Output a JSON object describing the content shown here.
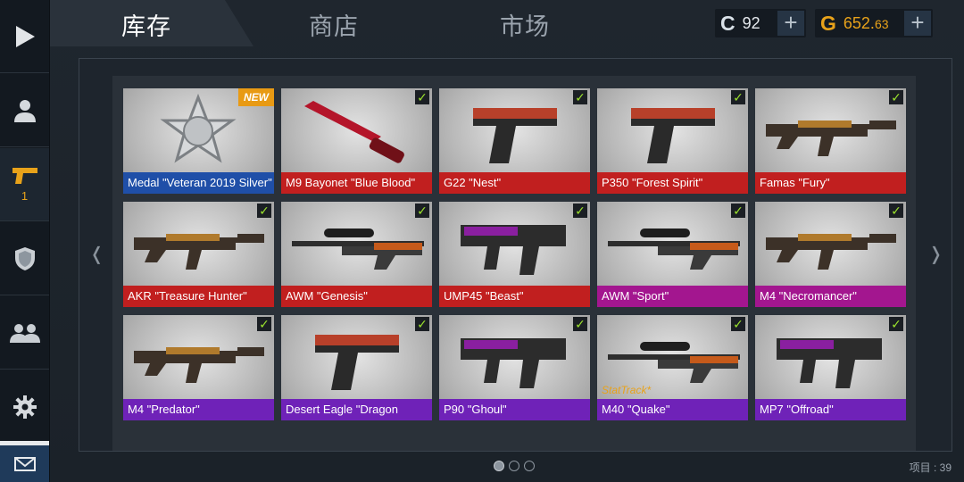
{
  "tabs": [
    {
      "label": "库存",
      "active": true
    },
    {
      "label": "商店",
      "active": false
    },
    {
      "label": "市场",
      "active": false
    }
  ],
  "currency": {
    "credits": {
      "icon": "C",
      "value": "92"
    },
    "gold": {
      "icon": "G",
      "value_main": "652.",
      "value_fraction": "63"
    }
  },
  "sidebar": {
    "inventory_count": "1"
  },
  "items": [
    {
      "name": "Medal \"Veteran 2019 Silver\"",
      "rarity_color": "#1f4fa8",
      "badge": "NEW",
      "icon": "medal-icon"
    },
    {
      "name": "M9 Bayonet \"Blue Blood\"",
      "rarity_color": "#c11f1f",
      "icon": "knife-icon"
    },
    {
      "name": "G22 \"Nest\"",
      "rarity_color": "#c11f1f",
      "icon": "pistol-icon"
    },
    {
      "name": "P350 \"Forest Spirit\"",
      "rarity_color": "#c11f1f",
      "icon": "pistol-icon"
    },
    {
      "name": "Famas \"Fury\"",
      "rarity_color": "#c11f1f",
      "icon": "rifle-icon"
    },
    {
      "name": "AKR \"Treasure Hunter\"",
      "rarity_color": "#c11f1f",
      "icon": "rifle-icon"
    },
    {
      "name": "AWM \"Genesis\"",
      "rarity_color": "#c11f1f",
      "icon": "sniper-icon"
    },
    {
      "name": "UMP45 \"Beast\"",
      "rarity_color": "#c11f1f",
      "icon": "smg-icon"
    },
    {
      "name": "AWM \"Sport\"",
      "rarity_color": "#a3168f",
      "icon": "sniper-icon"
    },
    {
      "name": "M4 \"Necromancer\"",
      "rarity_color": "#a3168f",
      "icon": "rifle-icon"
    },
    {
      "name": "M4 \"Predator\"",
      "rarity_color": "#6f22b8",
      "icon": "rifle-icon"
    },
    {
      "name": "Desert Eagle \"Dragon",
      "rarity_color": "#6f22b8",
      "icon": "pistol-icon"
    },
    {
      "name": "P90 \"Ghoul\"",
      "rarity_color": "#6f22b8",
      "icon": "smg-icon"
    },
    {
      "name": "M40 \"Quake\"",
      "rarity_color": "#6f22b8",
      "stattrack": "StatTrack*",
      "icon": "sniper-icon"
    },
    {
      "name": "MP7 \"Offroad\"",
      "rarity_color": "#6f22b8",
      "icon": "smg-icon"
    }
  ],
  "pager": {
    "pages": 3,
    "current": 1
  },
  "items_count_label": "项目 : 39",
  "nav": {
    "prev": "❬",
    "next": "❭"
  }
}
